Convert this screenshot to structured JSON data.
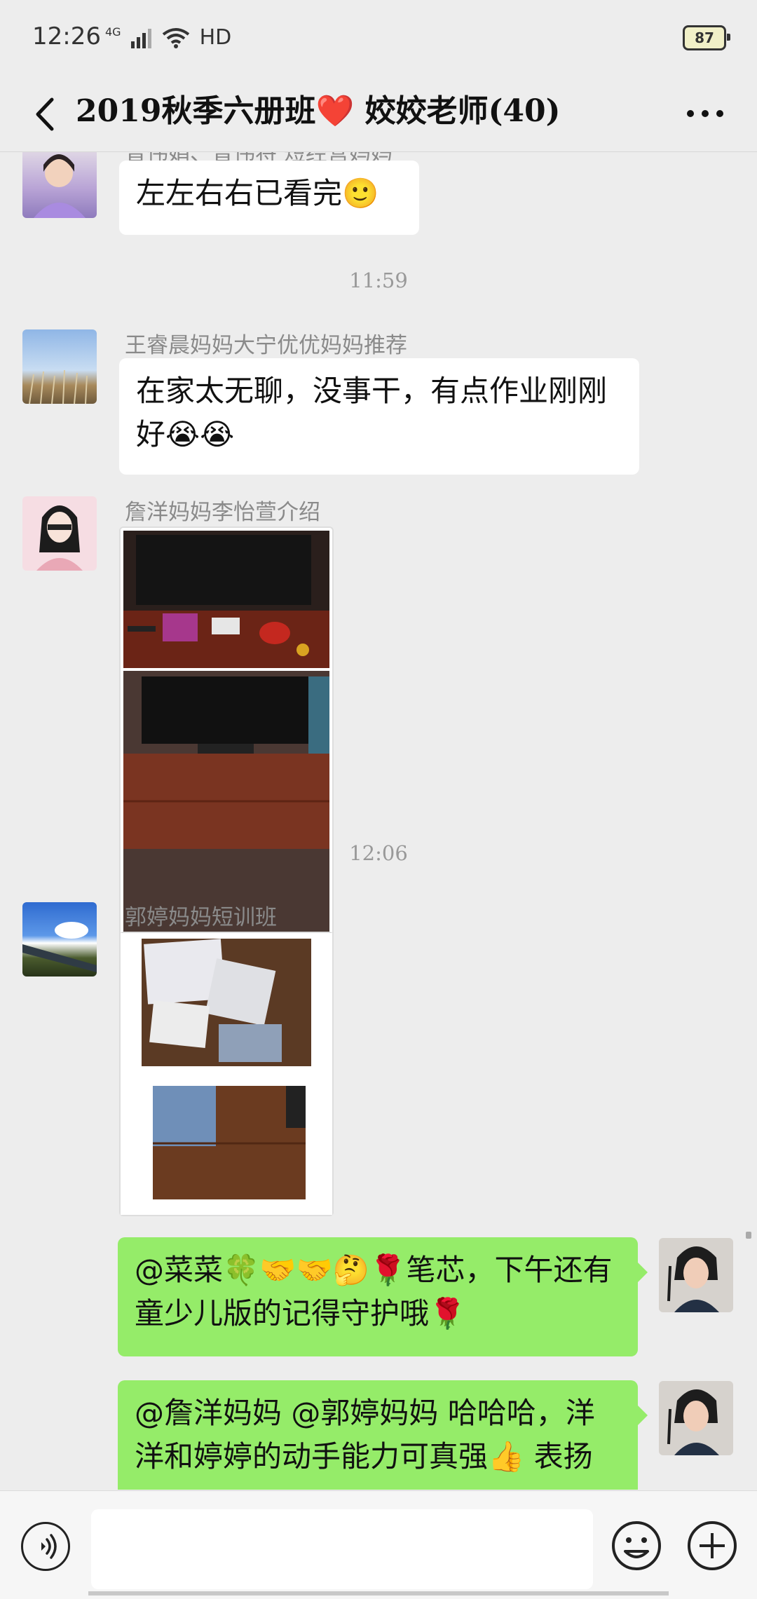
{
  "status": {
    "time": "12:26",
    "network": "4G",
    "hd": "HD",
    "battery": "87"
  },
  "nav": {
    "title": "2019秋季六册班❤️ 姣姣老师(40)"
  },
  "messages": {
    "m0": {
      "sender": "曾伟娟、曾伟将 短经营妈妈",
      "text": "左左右右已看完🙂"
    },
    "t1": "11:59",
    "m1": {
      "sender": "王睿晨妈妈大宁优优妈妈推荐",
      "text": "在家太无聊，没事干，有点作业刚刚好😭😭"
    },
    "m2": {
      "sender": "詹洋妈妈李怡萱介绍"
    },
    "t2": "12:06",
    "m3": {
      "sender": "郭婷妈妈短训班"
    },
    "m4": {
      "text": "@菜菜🍀🤝🤝🤔🌹笔芯，下午还有童少儿版的记得守护哦🌹"
    },
    "m5": {
      "text": "@詹洋妈妈 @郭婷妈妈  哈哈哈，洋洋和婷婷的动手能力可真强👍 表扬"
    }
  },
  "colors": {
    "bg": "#ededed",
    "bubble_green": "#95ec69",
    "bubble_white": "#ffffff"
  },
  "icons": [
    "back-icon",
    "more-icon",
    "voice-icon",
    "emoji-icon",
    "plus-icon"
  ]
}
